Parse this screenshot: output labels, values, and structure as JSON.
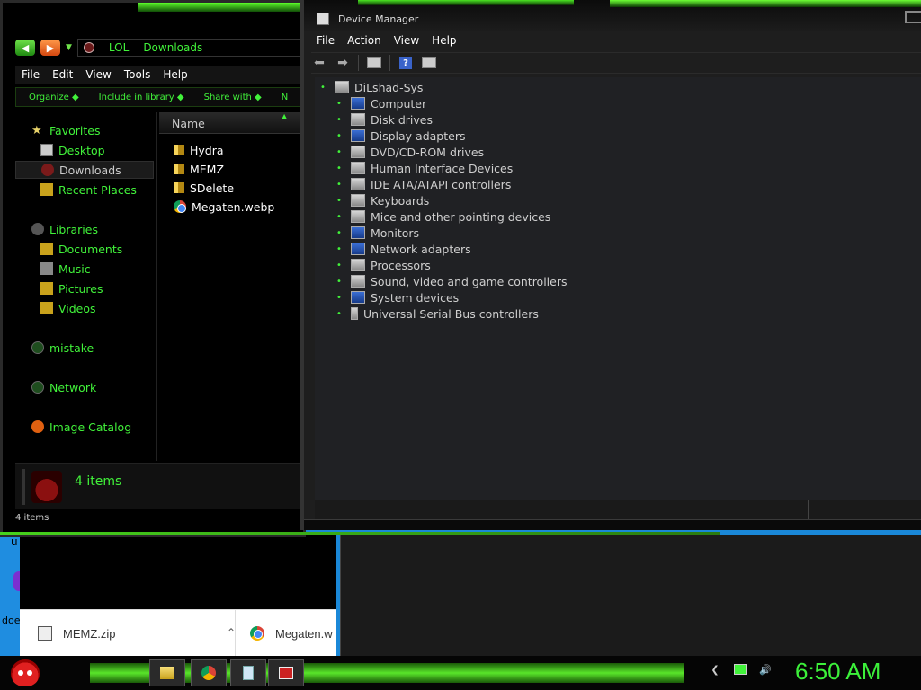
{
  "explorer": {
    "address": {
      "path1": "LOL",
      "path2": "Downloads"
    },
    "menu": [
      "File",
      "Edit",
      "View",
      "Tools",
      "Help"
    ],
    "toolbar": [
      "Organize ◆",
      "Include in library ◆",
      "Share with ◆",
      "N"
    ],
    "nav": {
      "favorites": "Favorites",
      "desktop": "Desktop",
      "downloads": "Downloads",
      "recent": "Recent Places",
      "libraries": "Libraries",
      "documents": "Documents",
      "music": "Music",
      "pictures": "Pictures",
      "videos": "Videos",
      "mistake": "mistake",
      "network": "Network",
      "image_catalog": "Image Catalog"
    },
    "column_name": "Name",
    "files": [
      "Hydra",
      "MEMZ",
      "SDelete",
      "Megaten.webp"
    ],
    "details_count": "4 items",
    "status": "4 items"
  },
  "devmgr": {
    "title": "Device Manager",
    "menu": [
      "File",
      "Action",
      "View",
      "Help"
    ],
    "root": "DiLshad-Sys",
    "devices": [
      "Computer",
      "Disk drives",
      "Display adapters",
      "DVD/CD-ROM drives",
      "Human Interface Devices",
      "IDE ATA/ATAPI controllers",
      "Keyboards",
      "Mice and other pointing devices",
      "Monitors",
      "Network adapters",
      "Processors",
      "Sound, video and game controllers",
      "System devices",
      "Universal Serial Bus controllers"
    ]
  },
  "browser": {
    "downloads": [
      "MEMZ.zip",
      "Megaten.w"
    ]
  },
  "desktop": {
    "fragment1": "u",
    "fragment2": "doe"
  },
  "taskbar": {
    "clock": "6:50 AM"
  },
  "colors": {
    "accent_green": "#41f23a",
    "clock_green": "#3cf03a"
  }
}
